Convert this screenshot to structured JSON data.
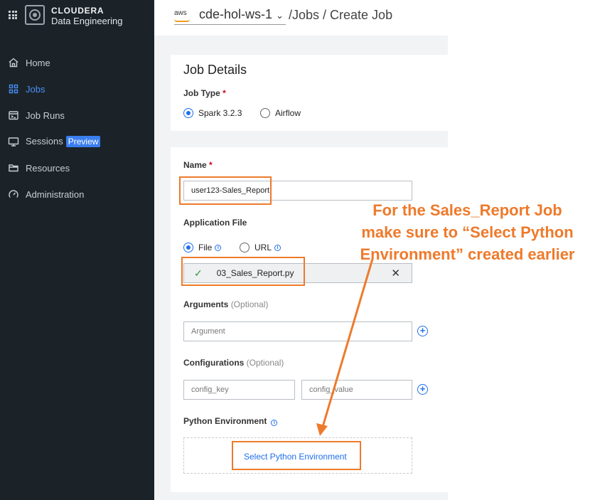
{
  "app": {
    "brand_name": "CLOUDERA",
    "brand_sub": "Data Engineering"
  },
  "sidebar": {
    "items": [
      {
        "label": "Home",
        "icon": "home-icon"
      },
      {
        "label": "Jobs",
        "icon": "jobs-icon",
        "active": true
      },
      {
        "label": "Job Runs",
        "icon": "job-runs-icon"
      },
      {
        "label": "Sessions",
        "icon": "sessions-icon",
        "badge": "Preview"
      },
      {
        "label": "Resources",
        "icon": "folder-icon"
      },
      {
        "label": "Administration",
        "icon": "gauge-icon"
      }
    ]
  },
  "header": {
    "cloud": "aws",
    "workspace": "cde-hol-ws-1",
    "breadcrumb": "/Jobs / Create Job"
  },
  "job_details": {
    "title": "Job Details",
    "job_type_label": "Job Type",
    "required_mark": "*",
    "job_types": [
      {
        "label": "Spark 3.2.3",
        "selected": true
      },
      {
        "label": "Airflow",
        "selected": false
      }
    ]
  },
  "form": {
    "name_label": "Name",
    "name_value": "user123-Sales_Report",
    "app_file_label": "Application File",
    "file_options": [
      {
        "label": "File",
        "selected": true
      },
      {
        "label": "URL",
        "selected": false
      }
    ],
    "file_value": "03_Sales_Report.py",
    "arguments_label": "Arguments",
    "optional_text": "(Optional)",
    "arguments_placeholder": "Argument",
    "configurations_label": "Configurations",
    "config_key_placeholder": "config_key",
    "config_value_placeholder": "config_value",
    "python_env_label": "Python Environment",
    "select_python_env": "Select Python Environment"
  },
  "annotation": {
    "line1": "For the Sales_Report Job",
    "line2": "make sure to “Select Python",
    "line3": "Environment” created earlier",
    "color": "#ee7a2b"
  }
}
